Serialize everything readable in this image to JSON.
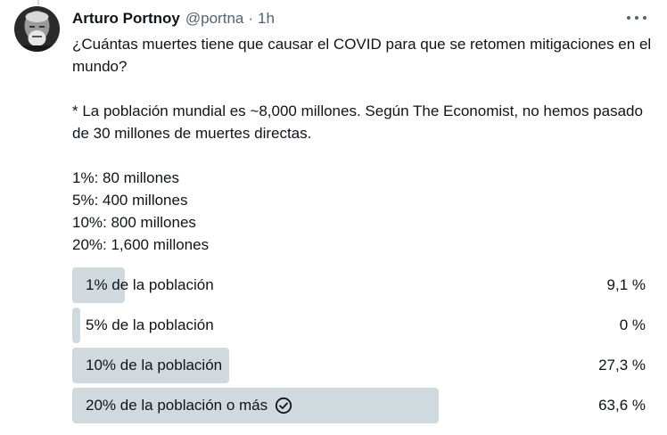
{
  "tweet": {
    "author": {
      "name": "Arturo Portnoy",
      "handle": "@portna",
      "separator": "·",
      "time": "1h"
    },
    "text": "¿Cuántas muertes tiene que causar el COVID para que se retomen mitigaciones en el mundo?\n\n* La población mundial es ~8,000 millones. Según The Economist, no hemos pasado de 30 millones de muertes directas.\n\n1%: 80 millones\n5%: 400 millones\n10%: 800 millones\n20%: 1,600 millones",
    "icons": {
      "avatar": "avatar-photo",
      "more": "more-options-icon",
      "winner": "check-circle-icon"
    }
  },
  "poll": {
    "options": [
      {
        "label": "1% de la población",
        "percent_text": "9,1 %",
        "fraction": 0.091,
        "winner": false
      },
      {
        "label": "5% de la población",
        "percent_text": "0 %",
        "fraction": 0.0,
        "winner": false
      },
      {
        "label": "10% de la población",
        "percent_text": "27,3 %",
        "fraction": 0.273,
        "winner": false
      },
      {
        "label": "20% de la población o más",
        "percent_text": "63,6 %",
        "fraction": 0.636,
        "winner": true
      }
    ],
    "colors": {
      "bar": "#cfd9de",
      "text": "#0f1419",
      "secondary": "#536471"
    }
  }
}
